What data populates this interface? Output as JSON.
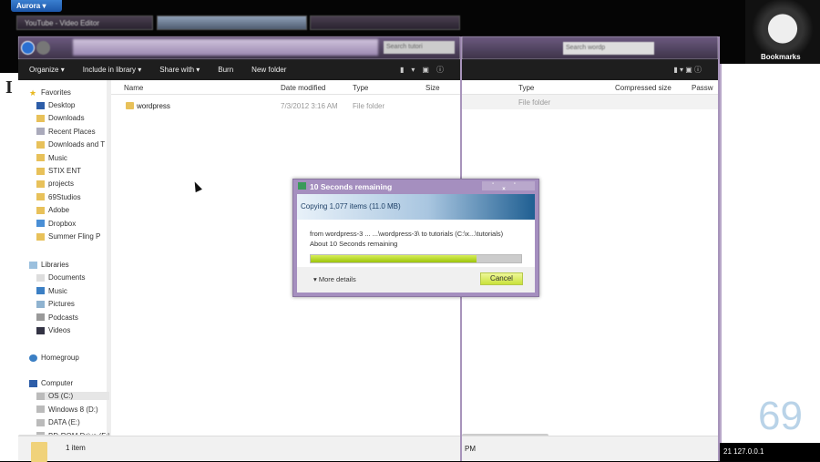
{
  "browser": {
    "menu_button": "Aurora",
    "tabs": [
      "YouTube - Video Editor",
      "",
      "",
      ""
    ]
  },
  "explorer": {
    "search_placeholder": "Search tutori",
    "toolbar": {
      "organize": "Organize",
      "include": "Include in library",
      "share": "Share with",
      "burn": "Burn",
      "new_folder": "New folder"
    },
    "columns": {
      "name": "Name",
      "date": "Date modified",
      "type": "Type",
      "size": "Size"
    },
    "files": [
      {
        "name": "wordpress",
        "date": "7/3/2012 3:16 AM",
        "type": "File folder"
      }
    ],
    "sidebar": {
      "favorites": "Favorites",
      "fav_items": [
        "Desktop",
        "Downloads",
        "Recent Places",
        "Downloads and T",
        "Music",
        "STIX ENT",
        "projects",
        "69Studios",
        "Adobe",
        "Dropbox",
        "Summer Fling P"
      ],
      "libraries": "Libraries",
      "lib_items": [
        "Documents",
        "Music",
        "Pictures",
        "Podcasts",
        "Videos"
      ],
      "homegroup": "Homegroup",
      "computer": "Computer",
      "drives": [
        "OS (C:)",
        "Windows 8 (D:)",
        "DATA (E:)",
        "BD-ROM Drive (F:)"
      ]
    },
    "status": "1 item"
  },
  "explorer2": {
    "search_placeholder": "Search wordp",
    "columns": {
      "type": "Type",
      "compressed": "Compressed size",
      "password": "Passw"
    },
    "row_type": "File folder",
    "status": "PM"
  },
  "dialog": {
    "title": "10 Seconds remaining",
    "header": "Copying 1,077 items (11.0 MB)",
    "from_line": "from wordpress-3 ... ...\\wordpress-3\\ to tutorials (C:\\x...\\tutorials)",
    "remaining": "About 10 Seconds remaining",
    "progress_percent": 79,
    "more_details": "More details",
    "cancel": "Cancel"
  },
  "right": {
    "bookmarks": "Bookmarks",
    "watermark": "69",
    "tray": "21  127.0.0.1"
  }
}
